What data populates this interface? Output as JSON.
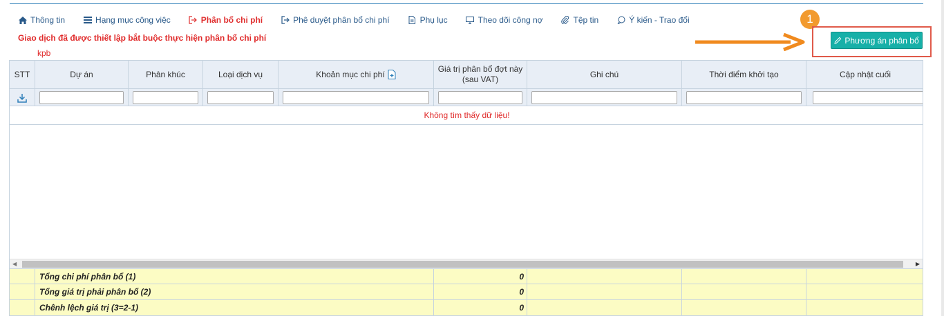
{
  "tabs": [
    {
      "label": "Thông tin",
      "icon": "home-icon"
    },
    {
      "label": "Hạng mục công việc",
      "icon": "list-icon"
    },
    {
      "label": "Phân bổ chi phí",
      "icon": "sign-out-icon",
      "active": true
    },
    {
      "label": "Phê duyệt phân bổ chi phí",
      "icon": "sign-out-icon"
    },
    {
      "label": "Phụ lục",
      "icon": "file-icon"
    },
    {
      "label": "Theo dõi công nợ",
      "icon": "monitor-icon"
    },
    {
      "label": "Tệp tin",
      "icon": "paperclip-icon"
    },
    {
      "label": "Ý kiến - Trao đổi",
      "icon": "comment-icon"
    }
  ],
  "warning": "Giao dịch đã được thiết lập bắt buộc thực hiện phân bổ chi phí",
  "kpb": "kpb",
  "annotation": {
    "step": "1",
    "color": "#f29a2e",
    "box_color": "#e05a4a"
  },
  "plan_button": {
    "label": "Phương án phân bổ",
    "icon": "pencil-icon",
    "color": "#17b0a8"
  },
  "table": {
    "columns": [
      "STT",
      "Dự án",
      "Phân khúc",
      "Loại dịch vụ",
      "Khoản mục chi phí",
      "Giá trị phân bổ đợt này (sau VAT)",
      "Ghi chú",
      "Thời điểm khởi tạo",
      "Cập nhật cuối"
    ],
    "empty_message": "Không tìm thấy dữ liệu!",
    "totals": [
      {
        "label": "Tổng chi phí phân bổ (1)",
        "value": "0"
      },
      {
        "label": "Tổng giá trị phải phân bổ (2)",
        "value": "0"
      },
      {
        "label": "Chênh lệch giá trị (3=2-1)",
        "value": "0"
      }
    ]
  },
  "colors": {
    "accent": "#2a5a8a",
    "active_tab": "#e03030",
    "header_bg": "#e8eef6",
    "totals_bg": "#fcfcc4"
  }
}
